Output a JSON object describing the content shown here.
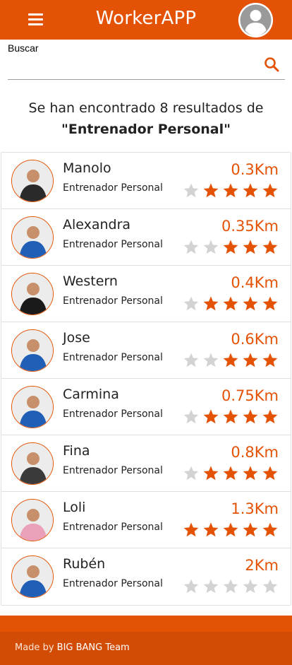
{
  "app": {
    "title": "WorkerAPP",
    "accent": "#e35205"
  },
  "search": {
    "label": "Buscar",
    "value": "",
    "icon": "search-icon"
  },
  "summary": {
    "prefix": "Se han encontrado 8 resultados de",
    "query": "\"Entrenador Personal\""
  },
  "results": [
    {
      "name": "Manolo",
      "role": "Entrenador Personal",
      "distance": "0.3Km",
      "rating": 4,
      "shirt": "#2a2a2a"
    },
    {
      "name": "Alexandra",
      "role": "Entrenador Personal",
      "distance": "0.35Km",
      "rating": 3,
      "shirt": "#1f5fb5"
    },
    {
      "name": "Western",
      "role": "Entrenador Personal",
      "distance": "0.4Km",
      "rating": 4,
      "shirt": "#1a1a1a"
    },
    {
      "name": "Jose",
      "role": "Entrenador Personal",
      "distance": "0.6Km",
      "rating": 3,
      "shirt": "#1f5fb5"
    },
    {
      "name": "Carmina",
      "role": "Entrenador Personal",
      "distance": "0.75Km",
      "rating": 4,
      "shirt": "#1f5fb5"
    },
    {
      "name": "Fina",
      "role": "Entrenador Personal",
      "distance": "0.8Km",
      "rating": 4,
      "shirt": "#3a3a3a"
    },
    {
      "name": "Loli",
      "role": "Entrenador Personal",
      "distance": "1.3Km",
      "rating": 5,
      "shirt": "#e9a0b8"
    },
    {
      "name": "Rubén",
      "role": "Entrenador Personal",
      "distance": "2Km",
      "rating": 0,
      "shirt": "#1f5fb5"
    }
  ],
  "footer": {
    "prefix": "Made by",
    "team": "BIG BANG Team"
  }
}
